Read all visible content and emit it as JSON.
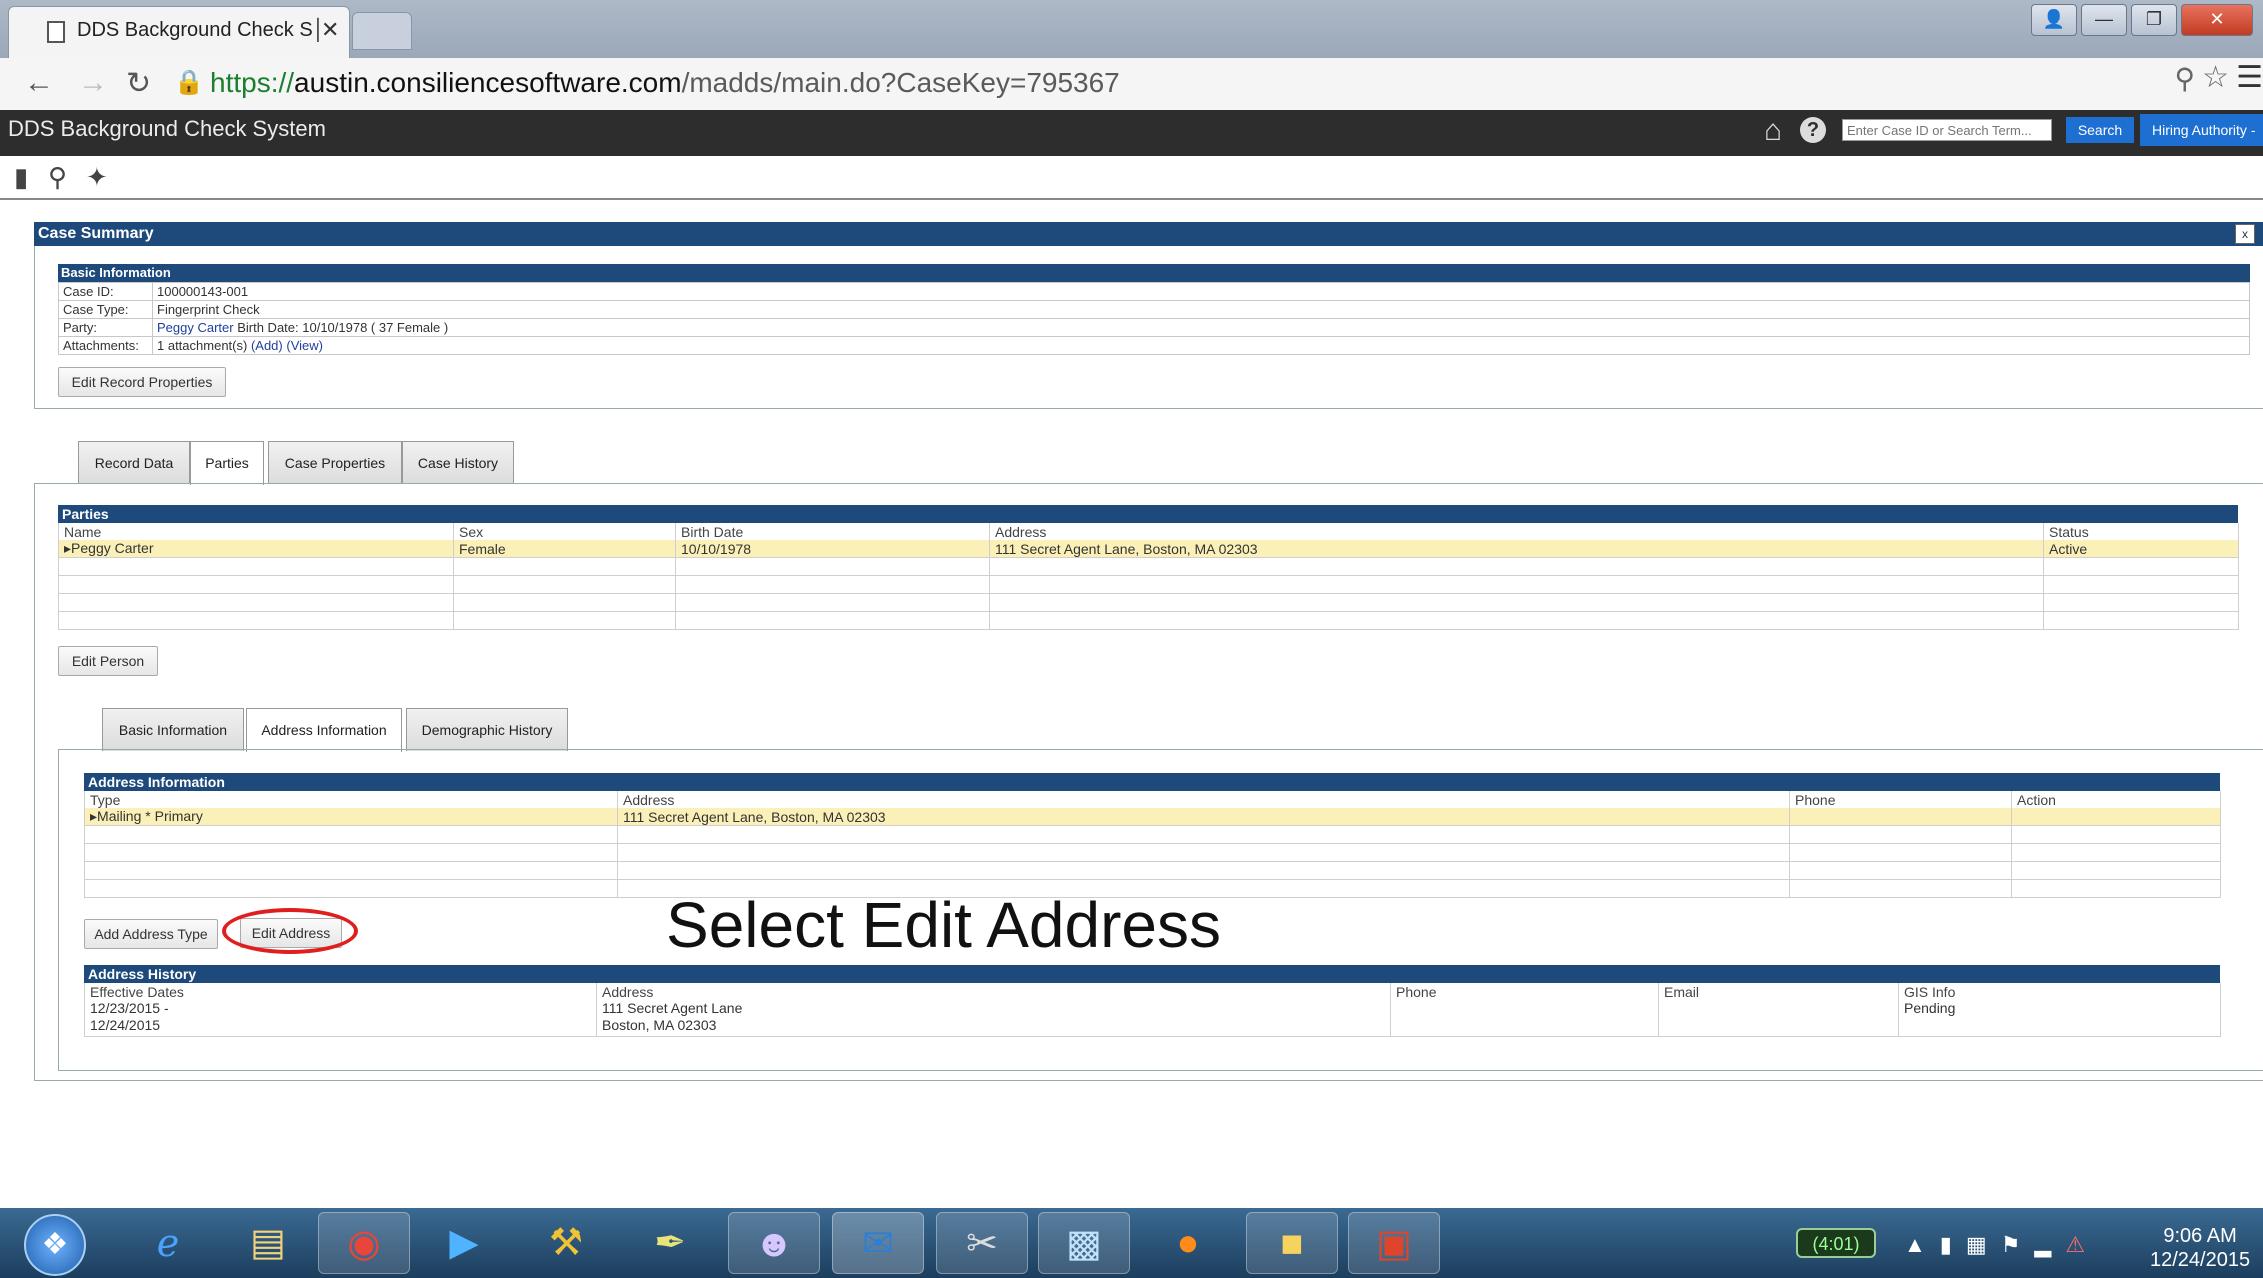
{
  "browser": {
    "tab_title": "DDS Background Check S│",
    "tab_close": "✕",
    "url_scheme": "https://",
    "url_host": "austin.consiliencesoftware.com",
    "url_path": "/madds/main.do?CaseKey=795367",
    "window_controls": [
      "👤",
      "—",
      "❐",
      "✕"
    ]
  },
  "app": {
    "title": "DDS Background Check System",
    "search_placeholder": "Enter Case ID or Search Term...",
    "search_button": "Search",
    "role_button": "Hiring Authority -"
  },
  "case_summary": {
    "header": "Case Summary",
    "close": "x",
    "basic_info_header": "Basic Information",
    "rows": [
      {
        "key": "Case ID:",
        "value": "100000143-001"
      },
      {
        "key": "Case Type:",
        "value": "Fingerprint Check"
      },
      {
        "key": "Party:",
        "party_name": "Peggy Carter",
        "value": "Birth Date: 10/10/1978 ( 37 Female )"
      },
      {
        "key": "Attachments:",
        "value": "1 attachment(s)",
        "add": "(Add)",
        "view": "(View)"
      }
    ],
    "edit_record_button": "Edit Record Properties"
  },
  "main_tabs": [
    "Record Data",
    "Parties",
    "Case Properties",
    "Case History"
  ],
  "parties": {
    "header": "Parties",
    "columns": [
      "Name",
      "Sex",
      "Birth Date",
      "Address",
      "Status"
    ],
    "rows": [
      [
        "▸Peggy Carter",
        "Female",
        "10/10/1978",
        "111 Secret Agent Lane, Boston, MA 02303",
        "Active"
      ]
    ],
    "edit_person_button": "Edit Person"
  },
  "person_tabs": [
    "Basic Information",
    "Address Information",
    "Demographic History"
  ],
  "address_info": {
    "header": "Address Information",
    "columns": [
      "Type",
      "Address",
      "Phone",
      "Action"
    ],
    "rows": [
      [
        "▸Mailing * Primary",
        "111 Secret Agent Lane, Boston, MA 02303",
        "",
        ""
      ]
    ],
    "add_type_button": "Add Address Type",
    "edit_address_button": "Edit Address"
  },
  "annotation": "Select Edit Address",
  "address_history": {
    "header": "Address History",
    "columns": [
      "Effective Dates",
      "Address",
      "Phone",
      "Email",
      "GIS Info"
    ],
    "row": {
      "dates_1": "12/23/2015 -",
      "dates_2": "12/24/2015",
      "address_1": "111 Secret Agent Lane",
      "address_2": "Boston, MA 02303",
      "phone": "",
      "email": "",
      "gis": "Pending"
    }
  },
  "taskbar": {
    "battery": "(4:01)",
    "time": "9:06 AM",
    "date": "12/24/2015"
  }
}
